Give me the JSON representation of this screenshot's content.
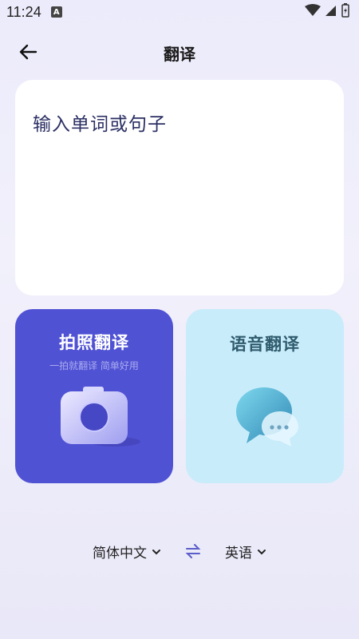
{
  "status_bar": {
    "time": "11:24",
    "notification_badge": "A"
  },
  "header": {
    "title": "翻译"
  },
  "input": {
    "placeholder": "输入单词或句子"
  },
  "cards": {
    "photo": {
      "title": "拍照翻译",
      "subtitle": "一拍就翻译 简单好用",
      "icon": "camera-icon"
    },
    "voice": {
      "title": "语音翻译",
      "icon": "chat-bubble-icon"
    }
  },
  "languages": {
    "source": "简体中文",
    "target": "英语"
  },
  "colors": {
    "photo_card": "#5052d4",
    "voice_card": "#c8ecfa",
    "background": "#ecebfb",
    "input_text": "#2b2f63"
  }
}
